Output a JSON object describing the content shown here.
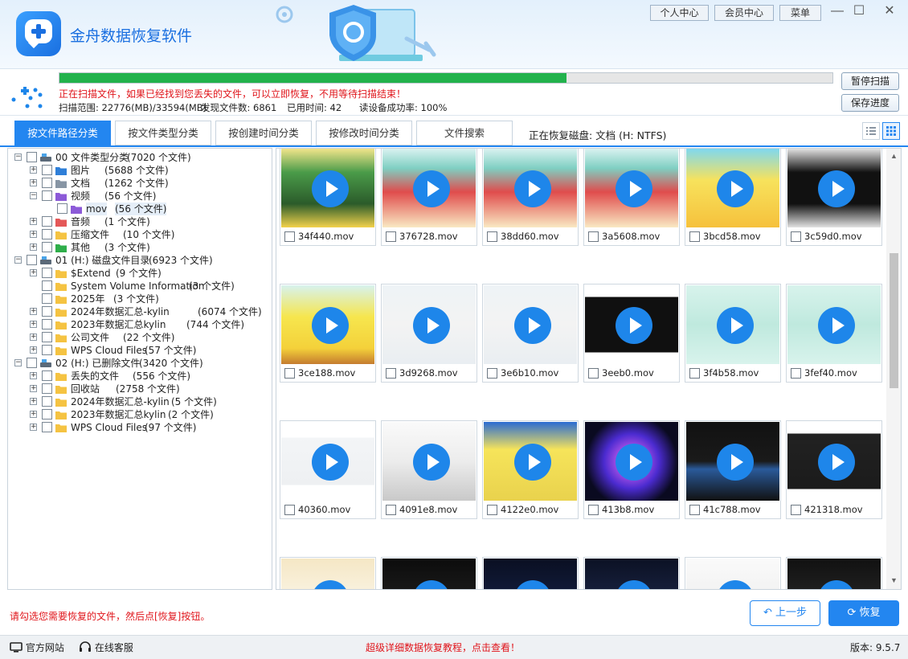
{
  "app": {
    "title": "金舟数据恢复软件"
  },
  "top_buttons": {
    "personal": "个人中心",
    "member": "会员中心",
    "menu": "菜单"
  },
  "window_controls": {
    "minimize": "—",
    "maximize": "☐",
    "close": "✕"
  },
  "scan": {
    "progress": 0.656,
    "message": "正在扫描文件，如果已经找到您丢失的文件，可以立即恢复，不用等待扫描结束！",
    "range": "扫描范围: 22776(MB)/33594(MB)",
    "found": "发现文件数: 6861",
    "elapsed": "已用时间: 42",
    "success_rate": "读设备成功率: 100%",
    "pause_label": "暂停扫描",
    "save_label": "保存进度"
  },
  "tabs": [
    "按文件路径分类",
    "按文件类型分类",
    "按创建时间分类",
    "按修改时间分类",
    "文件搜索"
  ],
  "disk_label": "正在恢复磁盘: 文档 (H: NTFS)",
  "tree": [
    {
      "label": "00 文件类型分类",
      "count": "(7020 个文件)",
      "icon": "drive-icon"
    },
    {
      "label": "图片",
      "count": "(5688 个文件)",
      "icon": "image-folder-icon"
    },
    {
      "label": "文档",
      "count": "(1262 个文件)",
      "icon": "doc-folder-icon"
    },
    {
      "label": "视频",
      "count": "(56 个文件)",
      "icon": "video-folder-icon"
    },
    {
      "label": "mov",
      "count": "(56 个文件)",
      "icon": "video-folder-icon"
    },
    {
      "label": "音频",
      "count": "(1 个文件)",
      "icon": "audio-folder-icon"
    },
    {
      "label": "压缩文件",
      "count": "(10 个文件)",
      "icon": "folder-icon"
    },
    {
      "label": "其他",
      "count": "(3 个文件)",
      "icon": "green-folder-icon"
    },
    {
      "label": "01 (H:) 磁盘文件目录",
      "count": "(6923 个文件)",
      "icon": "drive-icon"
    },
    {
      "label": "$Extend",
      "count": "(9 个文件)",
      "icon": "folder-icon"
    },
    {
      "label": "System Volume Information",
      "count": "(3 个文件)",
      "icon": "folder-icon"
    },
    {
      "label": "2025年",
      "count": "(3 个文件)",
      "icon": "folder-icon"
    },
    {
      "label": "2024年数据汇总-kylin",
      "count": "(6074 个文件)",
      "icon": "folder-icon"
    },
    {
      "label": "2023年数据汇总kylin",
      "count": "(744 个文件)",
      "icon": "folder-icon"
    },
    {
      "label": "公司文件",
      "count": "(22 个文件)",
      "icon": "folder-icon"
    },
    {
      "label": "WPS Cloud Files",
      "count": "(57 个文件)",
      "icon": "folder-icon"
    },
    {
      "label": "02 (H:) 已删除文件",
      "count": "(3420 个文件)",
      "icon": "drive-icon"
    },
    {
      "label": "丢失的文件",
      "count": "(556 个文件)",
      "icon": "folder-icon"
    },
    {
      "label": "回收站",
      "count": "(2758 个文件)",
      "icon": "folder-icon"
    },
    {
      "label": "2024年数据汇总-kylin",
      "count": "(5 个文件)",
      "icon": "folder-icon"
    },
    {
      "label": "2023年数据汇总kylin",
      "count": "(2 个文件)",
      "icon": "folder-icon"
    },
    {
      "label": "WPS Cloud Files",
      "count": "(97 个文件)",
      "icon": "folder-icon"
    }
  ],
  "files": [
    "34f440.mov",
    "376728.mov",
    "38dd60.mov",
    "3a5608.mov",
    "3bcd58.mov",
    "3c59d0.mov",
    "3ce188.mov",
    "3d9268.mov",
    "3e6b10.mov",
    "3eeb0.mov",
    "3f4b58.mov",
    "3fef40.mov",
    "40360.mov",
    "4091e8.mov",
    "4122e0.mov",
    "413b8.mov",
    "41c788.mov",
    "421318.mov",
    "",
    "",
    "",
    "",
    "",
    ""
  ],
  "footer": {
    "hint": "请勾选您需要恢复的文件，然后点[恢复]按钮。",
    "prev_label": "上一步",
    "recover_label": "恢复",
    "website": "官方网站",
    "support": "在线客服",
    "tutorial": "超级详细数据恢复教程，点击查看！",
    "version": "版本: 9.5.7"
  }
}
